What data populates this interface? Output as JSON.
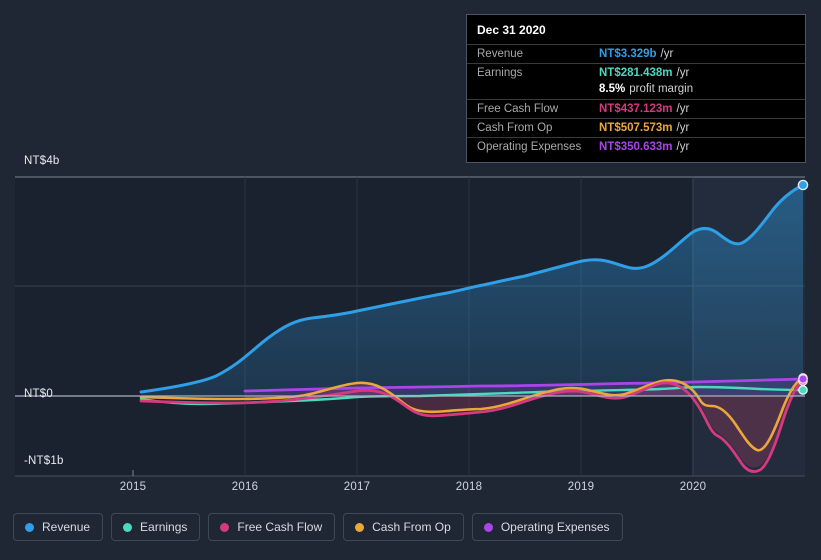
{
  "tooltip": {
    "date": "Dec 31 2020",
    "rows": [
      {
        "label": "Revenue",
        "value": "NT$3.329b",
        "suffix": "/yr",
        "color": "#2f9fe8"
      },
      {
        "label": "Earnings",
        "value": "NT$281.438m",
        "suffix": "/yr",
        "color": "#4cd9c0"
      },
      {
        "label": "Free Cash Flow",
        "value": "NT$437.123m",
        "suffix": "/yr",
        "color": "#d6397f"
      },
      {
        "label": "Cash From Op",
        "value": "NT$507.573m",
        "suffix": "/yr",
        "color": "#eba83a"
      },
      {
        "label": "Operating Expenses",
        "value": "NT$350.633m",
        "suffix": "/yr",
        "color": "#a846e8"
      }
    ],
    "profit_margin": {
      "value": "8.5%",
      "label": "profit margin"
    }
  },
  "legend": {
    "items": [
      {
        "label": "Revenue",
        "color": "#2f9fe8"
      },
      {
        "label": "Earnings",
        "color": "#4cd9c0"
      },
      {
        "label": "Free Cash Flow",
        "color": "#d6397f"
      },
      {
        "label": "Cash From Op",
        "color": "#eba83a"
      },
      {
        "label": "Operating Expenses",
        "color": "#a846e8"
      }
    ]
  },
  "chart_data": {
    "type": "area",
    "title": "",
    "xlabel": "",
    "ylabel": "",
    "currency": "NT$",
    "grid": true,
    "legend_position": "bottom",
    "ylim": [
      -1.0,
      4.0
    ],
    "y_unit": "billions NT$",
    "y_ticks": [
      {
        "value": 4,
        "label": "NT$4b"
      },
      {
        "value": 0,
        "label": "NT$0"
      },
      {
        "value": -1,
        "label": "-NT$1b"
      }
    ],
    "x_ticks": [
      "2015",
      "2016",
      "2017",
      "2018",
      "2019",
      "2020"
    ],
    "x": [
      "2014.3",
      "2014.7",
      "2015.0",
      "2015.3",
      "2015.7",
      "2016.0",
      "2016.3",
      "2016.7",
      "2017.0",
      "2017.3",
      "2017.7",
      "2018.0",
      "2018.3",
      "2018.7",
      "2019.0",
      "2019.3",
      "2019.7",
      "2020.0",
      "2020.3",
      "2020.7",
      "2021.0"
    ],
    "series": [
      {
        "name": "Revenue",
        "color": "#2f9fe8",
        "values": [
          0.07,
          0.15,
          0.37,
          0.78,
          1.06,
          1.4,
          1.55,
          1.66,
          1.78,
          1.9,
          2.03,
          2.12,
          2.2,
          2.32,
          2.46,
          2.43,
          2.55,
          2.88,
          3.0,
          3.22,
          3.85
        ],
        "last_value_label": "NT$3.329b"
      },
      {
        "name": "Earnings",
        "color": "#4cd9c0",
        "values": [
          -0.05,
          -0.09,
          -0.14,
          -0.13,
          -0.11,
          -0.09,
          -0.07,
          -0.03,
          -0.01,
          0.0,
          0.01,
          0.02,
          0.03,
          0.05,
          0.08,
          0.09,
          0.13,
          0.17,
          0.16,
          0.13,
          0.11
        ],
        "last_value_label": "NT$281.438m"
      },
      {
        "name": "Free Cash Flow",
        "color": "#d6397f",
        "values": [
          -0.09,
          -0.12,
          -0.13,
          -0.13,
          -0.12,
          -0.08,
          -0.02,
          0.09,
          0.1,
          -0.12,
          -0.32,
          -0.35,
          -0.32,
          -0.08,
          0.08,
          0.05,
          0.23,
          0.1,
          -0.7,
          -1.25,
          0.28
        ],
        "last_value_label": "NT$437.123m"
      },
      {
        "name": "Cash From Op",
        "color": "#eba83a",
        "values": [
          -0.02,
          -0.04,
          -0.05,
          -0.05,
          -0.04,
          0.0,
          0.06,
          0.24,
          0.25,
          -0.04,
          -0.22,
          -0.26,
          -0.24,
          0.0,
          0.13,
          0.05,
          0.26,
          0.04,
          -0.25,
          -0.99,
          0.33
        ],
        "last_value_label": "NT$507.573m"
      },
      {
        "name": "Operating Expenses",
        "color": "#a846e8",
        "values": [
          null,
          null,
          null,
          null,
          null,
          0.09,
          0.1,
          0.11,
          0.14,
          0.15,
          0.16,
          0.18,
          0.19,
          0.2,
          0.21,
          0.22,
          0.23,
          0.25,
          0.27,
          0.29,
          0.31
        ],
        "last_value_label": "NT$350.633m"
      }
    ],
    "highlight_region": {
      "from": "2020",
      "to": "2021",
      "note": "recent period shaded lighter"
    }
  }
}
